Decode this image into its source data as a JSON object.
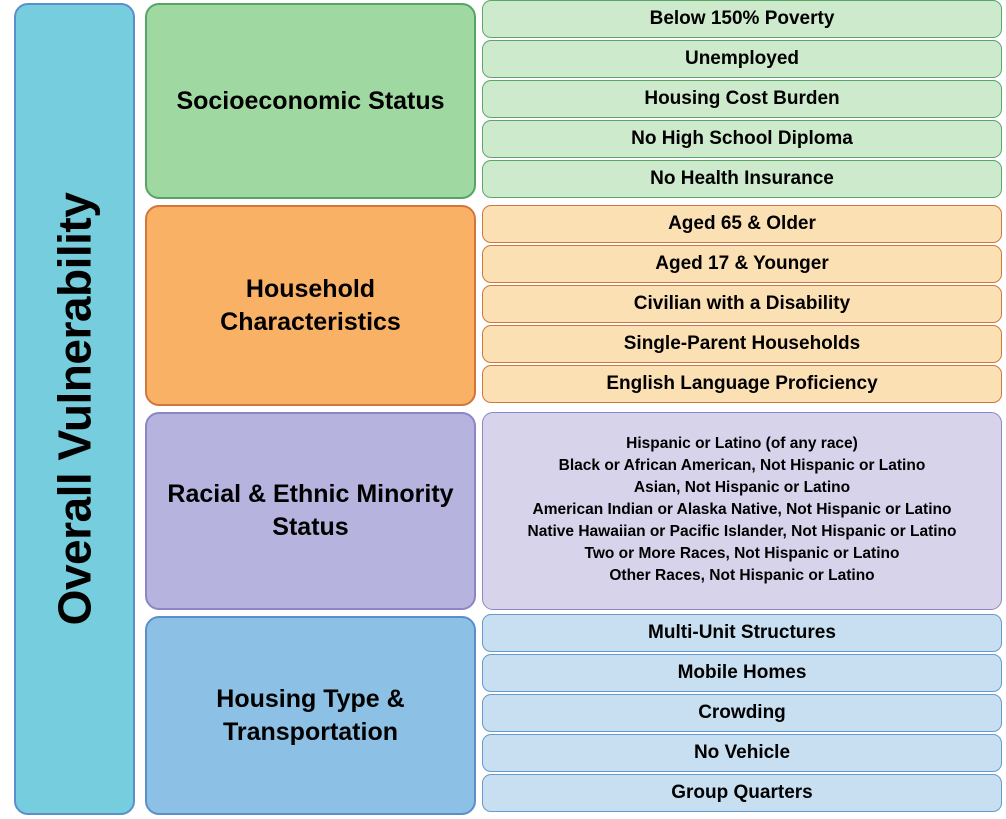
{
  "diagram": {
    "title": "Overall Vulnerability",
    "overall": {
      "label": "Overall Vulnerability",
      "color": "#76CDDD",
      "border_color": "#5B8FC9"
    },
    "themes": [
      {
        "name": "Socioeconomic Status",
        "color": "#9FD9A1",
        "border_color": "#56A566",
        "item_color": "#CDEACC",
        "items": [
          "Below 150% Poverty",
          "Unemployed",
          "Housing Cost Burden",
          "No High School Diploma",
          "No Health Insurance"
        ]
      },
      {
        "name": "Household Characteristics",
        "color": "#F9B166",
        "border_color": "#D2763B",
        "item_color": "#FBE0B4",
        "items": [
          "Aged 65 & Older",
          "Aged 17 & Younger",
          "Civilian with a Disability",
          "Single-Parent Households",
          "English Language Proficiency"
        ]
      },
      {
        "name": "Racial & Ethnic Minority Status",
        "color": "#B6B3DE",
        "border_color": "#8C86C4",
        "item_color": "#D6D3EA",
        "items": [
          "Hispanic or Latino (of any race)",
          "Black or African American, Not Hispanic or Latino",
          "Asian, Not Hispanic or Latino",
          "American Indian or Alaska Native, Not Hispanic or Latino",
          "Native Hawaiian or Pacific Islander, Not Hispanic or Latino",
          "Two or More Races, Not Hispanic or Latino",
          "Other Races, Not Hispanic or Latino"
        ]
      },
      {
        "name": "Housing Type & Transportation",
        "color": "#8CC0E4",
        "border_color": "#5B8FC9",
        "item_color": "#C7DFF0",
        "items": [
          "Multi-Unit Structures",
          "Mobile Homes",
          "Crowding",
          "No Vehicle",
          "Group Quarters"
        ]
      }
    ]
  }
}
